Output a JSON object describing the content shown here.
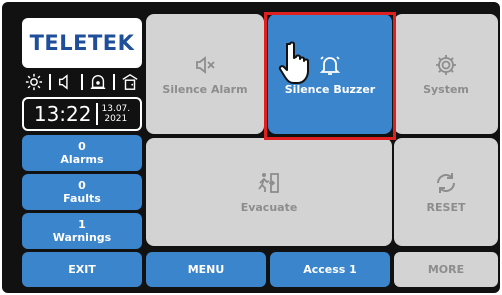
{
  "brand": {
    "logo_text": "TELETEK"
  },
  "status_icons": [
    "sun-icon",
    "volume-icon",
    "alarm-bell-icon",
    "door-icon"
  ],
  "clock": {
    "time": "13:22",
    "date_line1": "13.07.",
    "date_line2": "2021"
  },
  "side_buttons": [
    {
      "count": "0",
      "label": "Alarms"
    },
    {
      "count": "0",
      "label": "Faults"
    },
    {
      "count": "1",
      "label": "Warnings"
    }
  ],
  "tiles": {
    "silence_alarm": "Silence Alarm",
    "silence_buzzer": "Silence Buzzer",
    "system": "System",
    "evacuate": "Evacuate",
    "reset": "RESET"
  },
  "bottom_buttons": {
    "exit": "EXIT",
    "menu": "MENU",
    "access": "Access 1",
    "more": "MORE"
  },
  "colors": {
    "accent_blue": "#3b85cd",
    "tile_grey": "#d3d3d3",
    "highlight_red": "#e02020",
    "background": "#111111"
  }
}
